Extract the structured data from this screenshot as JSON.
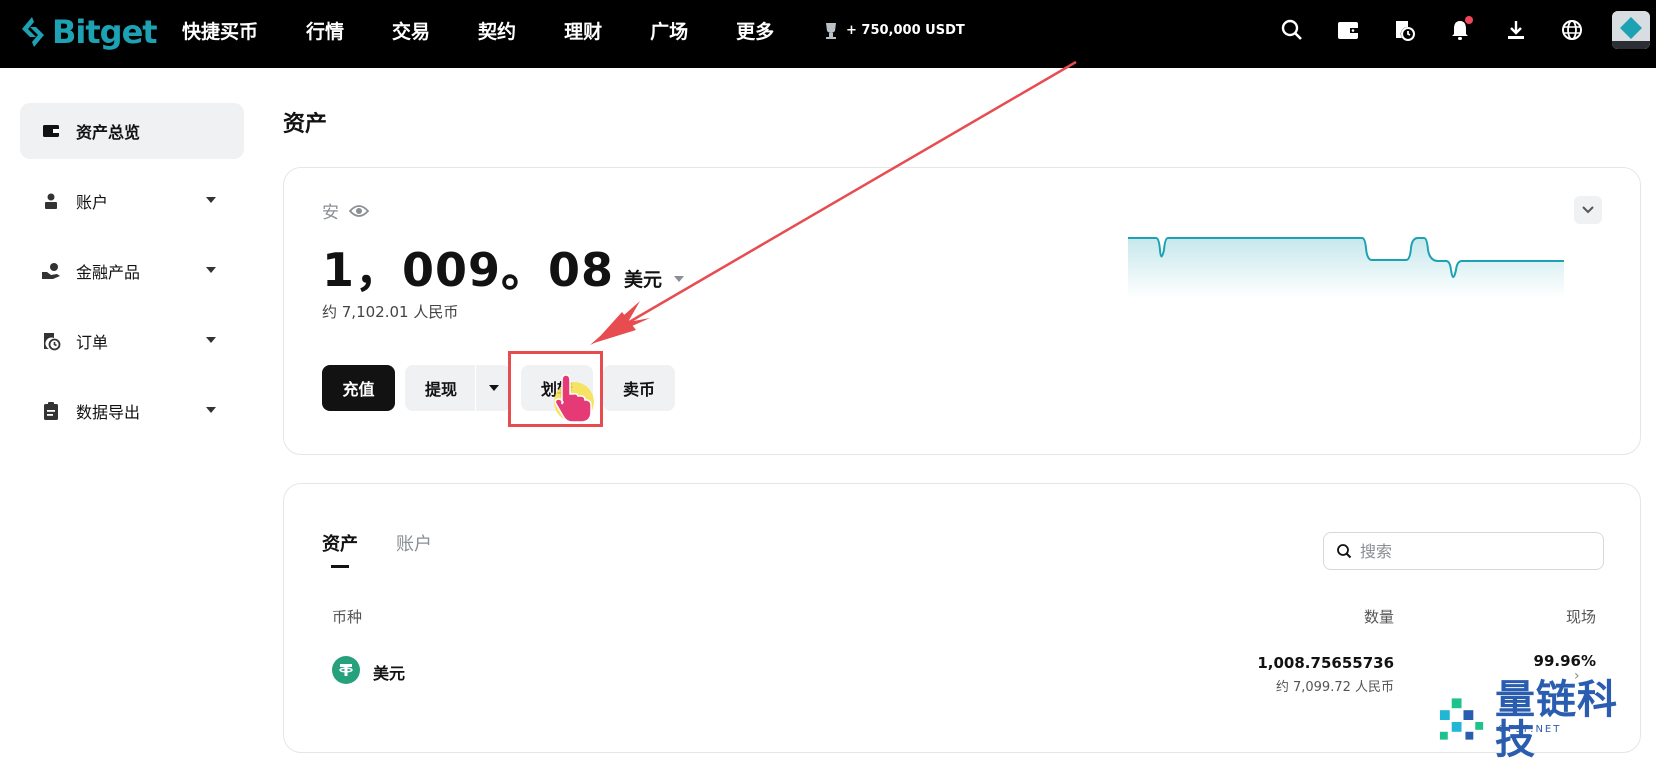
{
  "brand": {
    "name": "Bitget"
  },
  "nav": {
    "items": [
      "快捷买币",
      "行情",
      "交易",
      "契约",
      "理财",
      "广场",
      "更多"
    ],
    "promo_text": "+ 750,000 USDT"
  },
  "sidebar": {
    "items": [
      {
        "label": "资产总览",
        "icon": "wallet-icon",
        "active": true
      },
      {
        "label": "账户",
        "icon": "account-icon"
      },
      {
        "label": "金融产品",
        "icon": "finance-icon"
      },
      {
        "label": "订单",
        "icon": "order-icon"
      },
      {
        "label": "数据导出",
        "icon": "export-icon"
      }
    ]
  },
  "main": {
    "title": "资产",
    "overview": {
      "account_label": "安",
      "balance": "1，009。08",
      "unit": "美元",
      "approx": "约 7,102.01 人民币",
      "buttons": {
        "deposit": "充值",
        "withdraw": "提现",
        "transfer": "划转",
        "sell": "卖币"
      }
    },
    "holdings": {
      "tabs": [
        "资产",
        "账户"
      ],
      "search_placeholder": "搜索",
      "columns": {
        "coin": "币种",
        "quantity": "数量",
        "spot": "现场"
      },
      "rows": [
        {
          "coin": "美元",
          "quantity": "1,008.75655736",
          "quantity_approx": "约 7,099.72 人民币",
          "spot": "99.96%"
        }
      ]
    }
  },
  "watermark": {
    "text": "量链科技",
    "sub": "QFSP.NET"
  },
  "colors": {
    "brand": "#1da2b4",
    "annotation": "#e74c50",
    "tether": "#26a17b",
    "watermark": "#2a5db0"
  }
}
